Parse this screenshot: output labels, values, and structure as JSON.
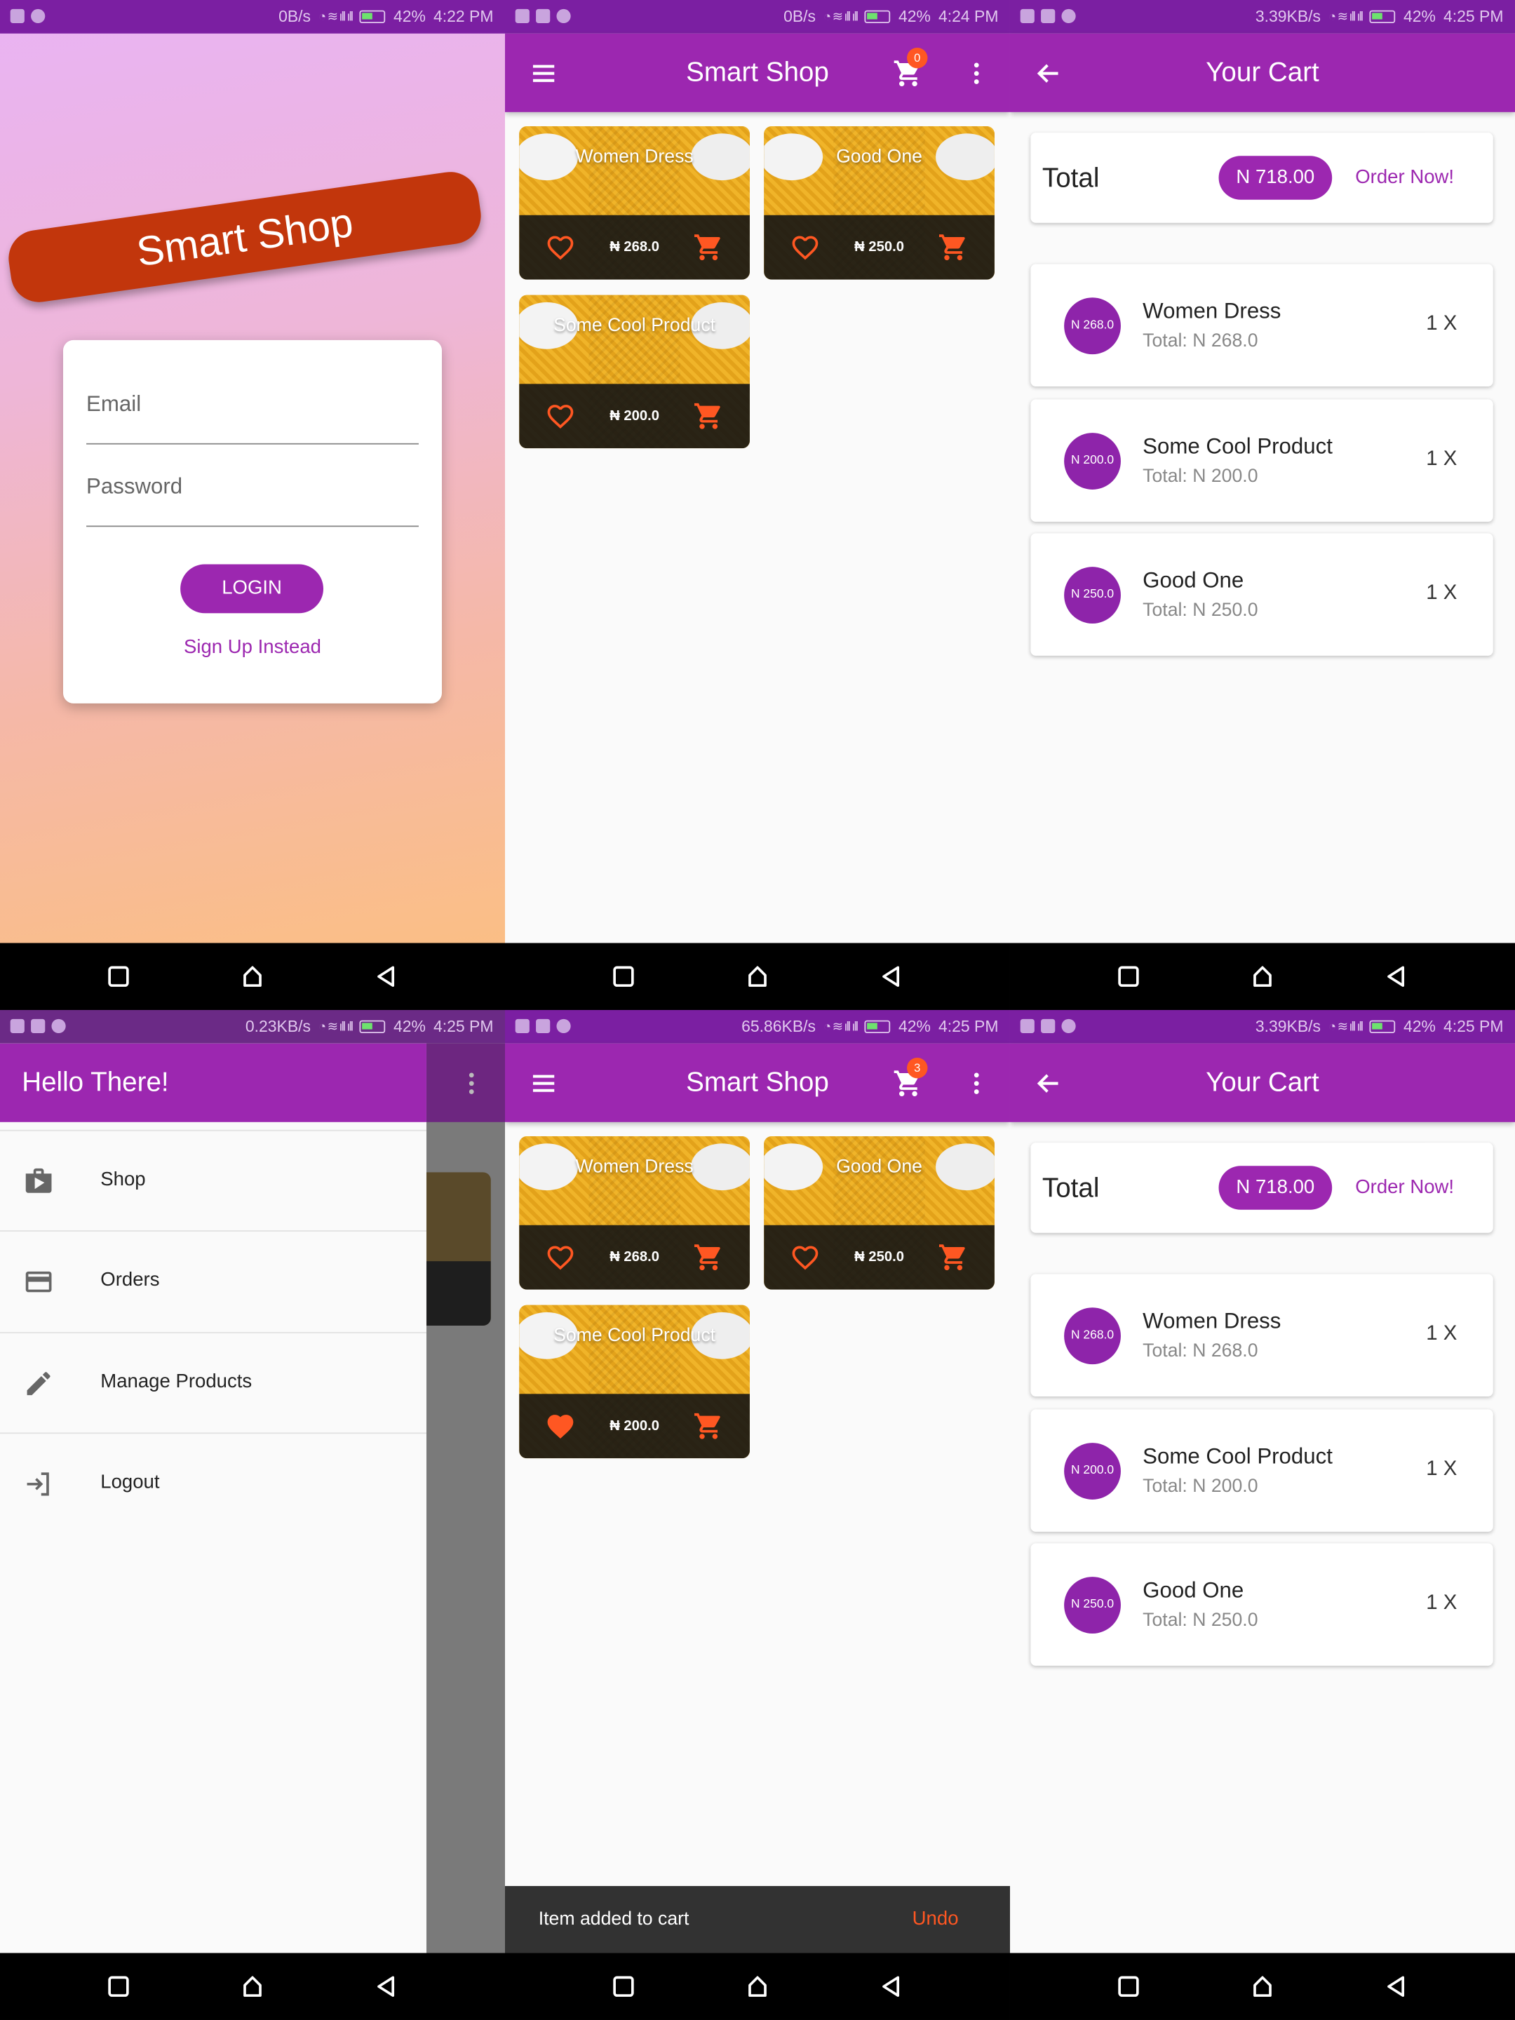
{
  "status_bars": [
    {
      "speed": "0B/s",
      "battery": "42%",
      "time": "4:22 PM"
    },
    {
      "speed": "0B/s",
      "battery": "42%",
      "time": "4:24 PM"
    },
    {
      "speed": "3.39KB/s",
      "battery": "42%",
      "time": "4:25 PM"
    },
    {
      "speed": "0.23KB/s",
      "battery": "42%",
      "time": "4:25 PM"
    },
    {
      "speed": "65.86KB/s",
      "battery": "42%",
      "time": "4:25 PM"
    },
    {
      "speed": "3.39KB/s",
      "battery": "42%",
      "time": "4:25 PM"
    }
  ],
  "login": {
    "banner": "Smart Shop",
    "email_label": "Email",
    "password_label": "Password",
    "login_button": "LOGIN",
    "signup_link": "Sign Up Instead"
  },
  "shop": {
    "title": "Smart Shop",
    "cart_badge_before": "0",
    "cart_badge_after": "3",
    "products": [
      {
        "name": "Women Dress",
        "price": "₦ 268.0"
      },
      {
        "name": "Good One",
        "price": "₦ 250.0"
      },
      {
        "name": "Some Cool Product",
        "price": "₦ 200.0"
      }
    ],
    "snackbar": {
      "message": "Item added to cart",
      "action": "Undo"
    }
  },
  "cart": {
    "title": "Your Cart",
    "total_label": "Total",
    "total_amount": "N 718.00",
    "order_button": "Order Now!",
    "items": [
      {
        "avatar": "N 268.0",
        "name": "Women Dress",
        "total": "Total: N 268.0",
        "qty": "1 X"
      },
      {
        "avatar": "N 200.0",
        "name": "Some Cool Product",
        "total": "Total: N 200.0",
        "qty": "1 X"
      },
      {
        "avatar": "N 250.0",
        "name": "Good One",
        "total": "Total: N 250.0",
        "qty": "1 X"
      }
    ]
  },
  "drawer": {
    "header": "Hello There!",
    "items": [
      {
        "label": "Shop",
        "icon": "shop-icon"
      },
      {
        "label": "Orders",
        "icon": "credit-card-icon"
      },
      {
        "label": "Manage Products",
        "icon": "edit-icon"
      },
      {
        "label": "Logout",
        "icon": "logout-icon"
      }
    ]
  },
  "colors": {
    "primary": "#9c27b0",
    "accent": "#ff5722",
    "banner": "#c2360c"
  },
  "icons": [
    "menu-icon",
    "cart-icon",
    "more-vert-icon",
    "back-arrow-icon",
    "heart-icon",
    "heart-filled-icon",
    "add-cart-icon",
    "nav-square-icon",
    "nav-home-icon",
    "nav-back-icon"
  ]
}
